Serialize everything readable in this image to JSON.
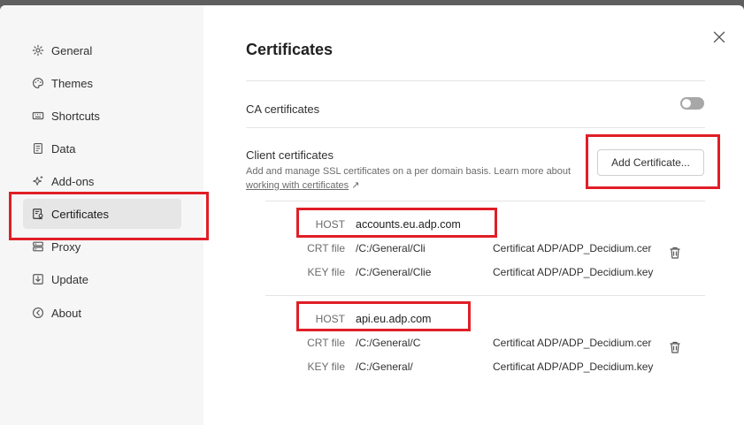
{
  "sidebar": {
    "items": [
      {
        "label": "General",
        "icon": "gear-icon"
      },
      {
        "label": "Themes",
        "icon": "palette-icon"
      },
      {
        "label": "Shortcuts",
        "icon": "keyboard-icon"
      },
      {
        "label": "Data",
        "icon": "data-icon"
      },
      {
        "label": "Add-ons",
        "icon": "sparkle-icon"
      },
      {
        "label": "Certificates",
        "icon": "certificate-icon",
        "active": true
      },
      {
        "label": "Proxy",
        "icon": "proxy-icon"
      },
      {
        "label": "Update",
        "icon": "download-icon"
      },
      {
        "label": "About",
        "icon": "info-icon"
      }
    ]
  },
  "main": {
    "title": "Certificates",
    "ca": {
      "label": "CA certificates",
      "enabled": false
    },
    "client": {
      "title": "Client certificates",
      "description": "Add and manage SSL certificates on a per domain basis. Learn more about",
      "link_text": "working with certificates",
      "link_arrow": "↗",
      "add_button": "Add Certificate..."
    },
    "certificates": [
      {
        "host_label": "HOST",
        "host": "accounts.eu.adp.com",
        "crt_label": "CRT file",
        "crt_prefix": "/C:/General/Cli",
        "crt_suffix": "Certificat ADP/ADP_Decidium.cer",
        "key_label": "KEY file",
        "key_prefix": "/C:/General/Clie",
        "key_suffix": "Certificat ADP/ADP_Decidium.key"
      },
      {
        "host_label": "HOST",
        "host": "api.eu.adp.com",
        "crt_label": "CRT file",
        "crt_prefix": "/C:/General/C",
        "crt_suffix": "Certificat ADP/ADP_Decidium.cer",
        "key_label": "KEY file",
        "key_prefix": "/C:/General/",
        "key_suffix": "Certificat ADP/ADP_Decidium.key"
      }
    ]
  },
  "colors": {
    "highlight": "#e01e26",
    "toggle_off": "#a7a7a7"
  }
}
